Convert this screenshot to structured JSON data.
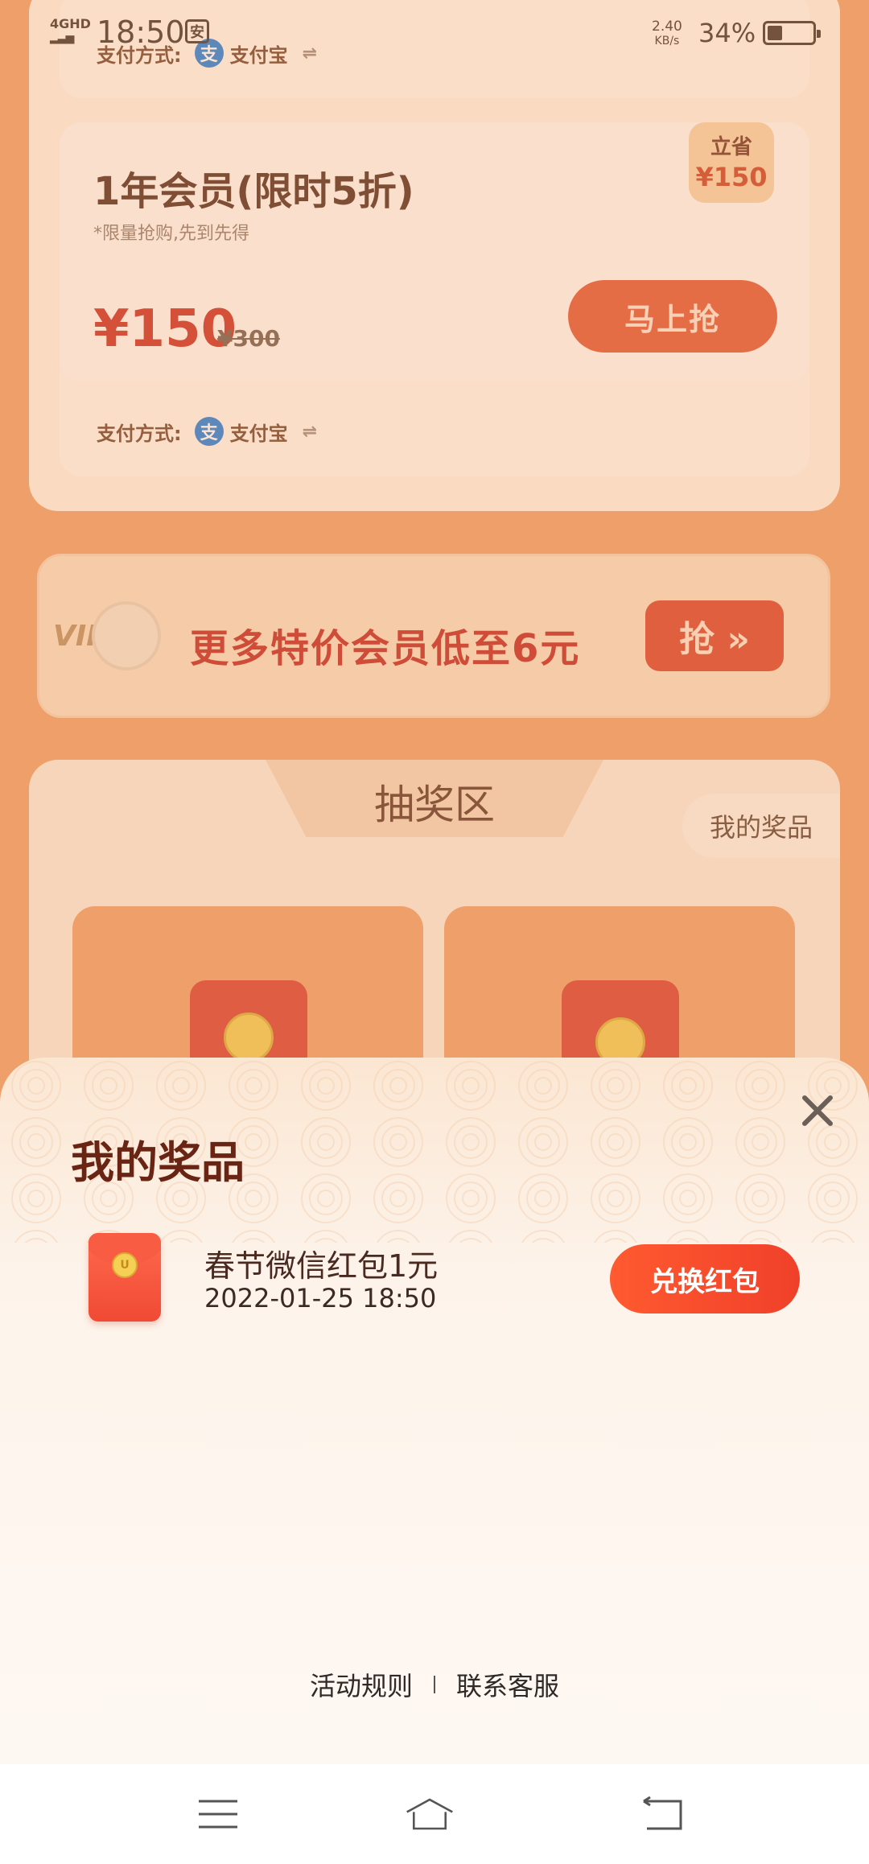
{
  "statusbar": {
    "network": "4GHD",
    "time": "18:50",
    "sim_badge": "安",
    "speed_value": "2.40",
    "speed_unit": "KB/s",
    "battery": "34%",
    "battery_level": 0.34
  },
  "background": {
    "pay_label": "支付方式:",
    "pay_method": "支付宝",
    "plan": {
      "title": "1年会员(限时5折)",
      "subtitle": "*限量抢购,先到先得",
      "price": "¥150",
      "original_price": "¥300",
      "save_label": "立省",
      "save_amount": "¥150",
      "buy_button": "马上抢"
    },
    "vip_banner": {
      "badge": "VIP",
      "text": "更多特价会员低至6元",
      "button": "抢 »"
    },
    "lottery": {
      "title": "抽奖区",
      "my_prizes": "我的奖品"
    }
  },
  "sheet": {
    "title": "我的奖品",
    "prizes": [
      {
        "name": "春节微信红包1元",
        "time": "2022-01-25 18:50",
        "action": "兑换红包",
        "icon": "red-envelope-icon"
      }
    ],
    "footer": {
      "rules": "活动规则",
      "support": "联系客服"
    }
  },
  "colors": {
    "accent": "#f0402a",
    "title": "#6a2414",
    "sheet_bg": "#fef8f3"
  }
}
